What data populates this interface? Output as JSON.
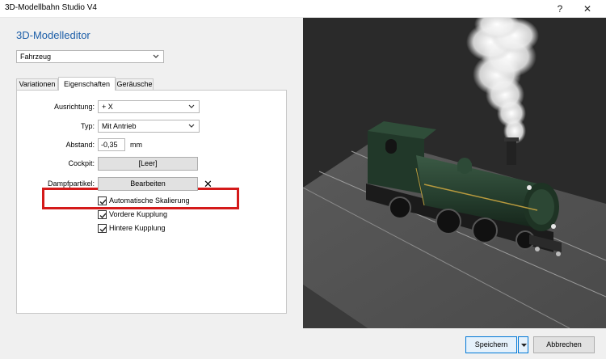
{
  "window": {
    "title": "3D-Modellbahn Studio V4",
    "help_glyph": "?",
    "close_glyph": "✕"
  },
  "editor": {
    "heading": "3D-Modelleditor",
    "type_select": "Fahrzeug"
  },
  "tabs": [
    {
      "label": "Variationen",
      "active": false
    },
    {
      "label": "Eigenschaften",
      "active": true
    },
    {
      "label": "Geräusche",
      "active": false
    }
  ],
  "properties": {
    "orientation": {
      "label": "Ausrichtung:",
      "value": "+ X"
    },
    "type": {
      "label": "Typ:",
      "value": "Mit Antrieb"
    },
    "distance": {
      "label": "Abstand:",
      "value": "-0,35",
      "unit": "mm"
    },
    "cockpit": {
      "label": "Cockpit:",
      "value": "[Leer]"
    },
    "steam": {
      "label": "Dampfpartikel:",
      "button": "Bearbeiten",
      "clear_glyph": "✕"
    }
  },
  "checkboxes": [
    {
      "label": "Automatische Skalierung",
      "checked": true
    },
    {
      "label": "Vordere Kupplung",
      "checked": true
    },
    {
      "label": "Hintere Kupplung",
      "checked": true
    }
  ],
  "footer": {
    "save_label": "Speichern",
    "cancel_label": "Abbrechen"
  },
  "colors": {
    "heading": "#1c5ea8",
    "highlight": "#d41a1a",
    "locomotive": "#27412f",
    "viewport_bg": "#2b2b2b",
    "primary_border": "#0078d7"
  },
  "icons": {
    "dropdown": "chevron-down-icon",
    "check": "checkmark-icon",
    "split": "triangle-down-icon"
  }
}
